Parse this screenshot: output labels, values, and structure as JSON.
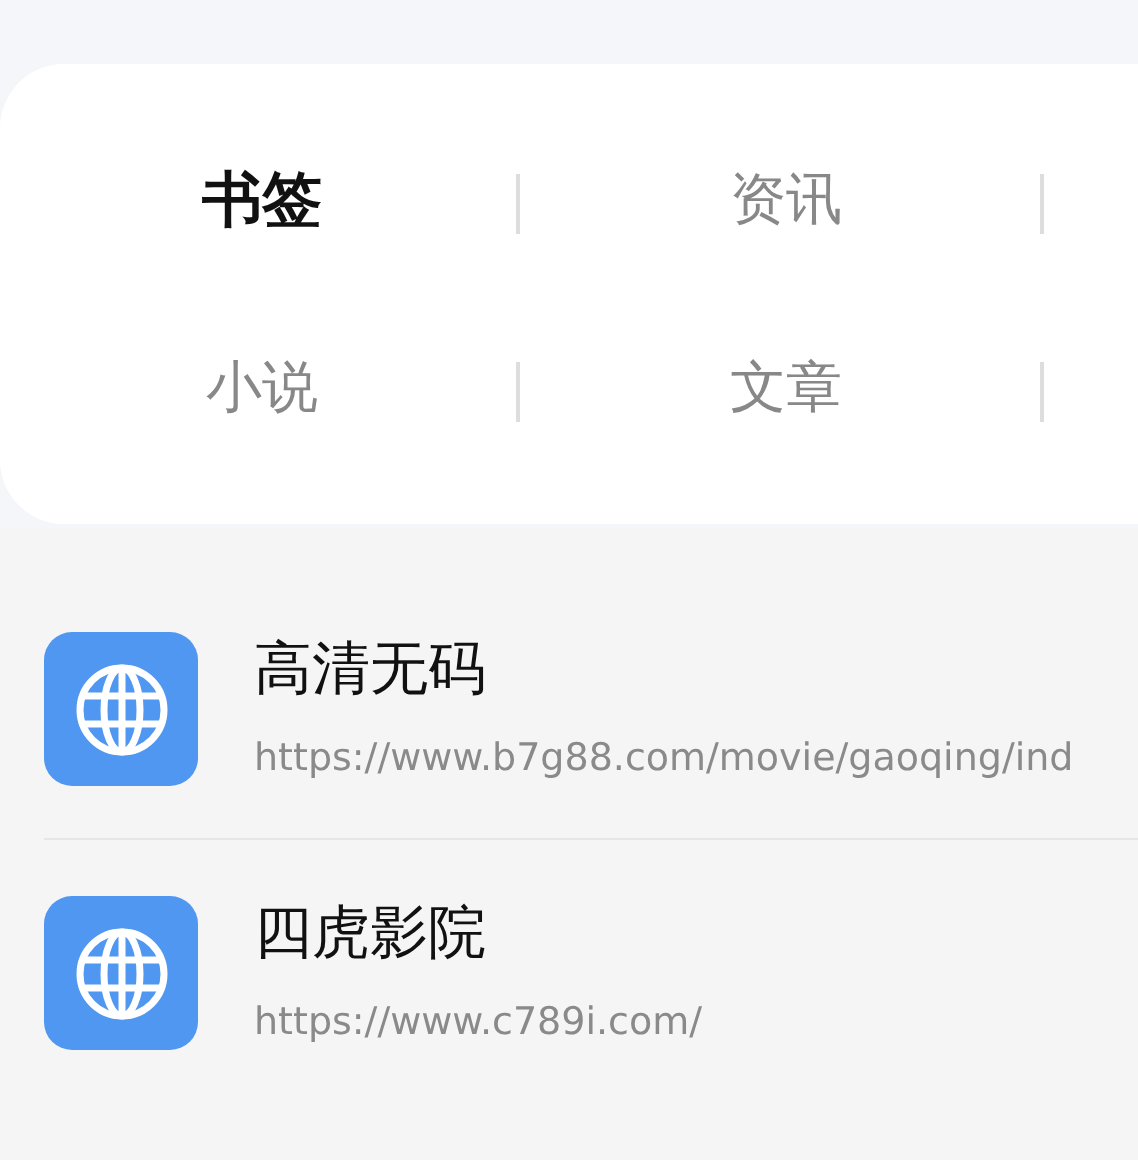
{
  "tabs": [
    {
      "label": "书签",
      "selected": true
    },
    {
      "label": "资讯",
      "selected": false
    },
    {
      "label": "小说",
      "selected": false
    },
    {
      "label": "文章",
      "selected": false
    }
  ],
  "bookmarks": [
    {
      "title": "高清无码",
      "url": "https://www.b7g88.com/movie/gaoqing/ind"
    },
    {
      "title": "四虎影院",
      "url": "https://www.c789i.com/"
    }
  ]
}
